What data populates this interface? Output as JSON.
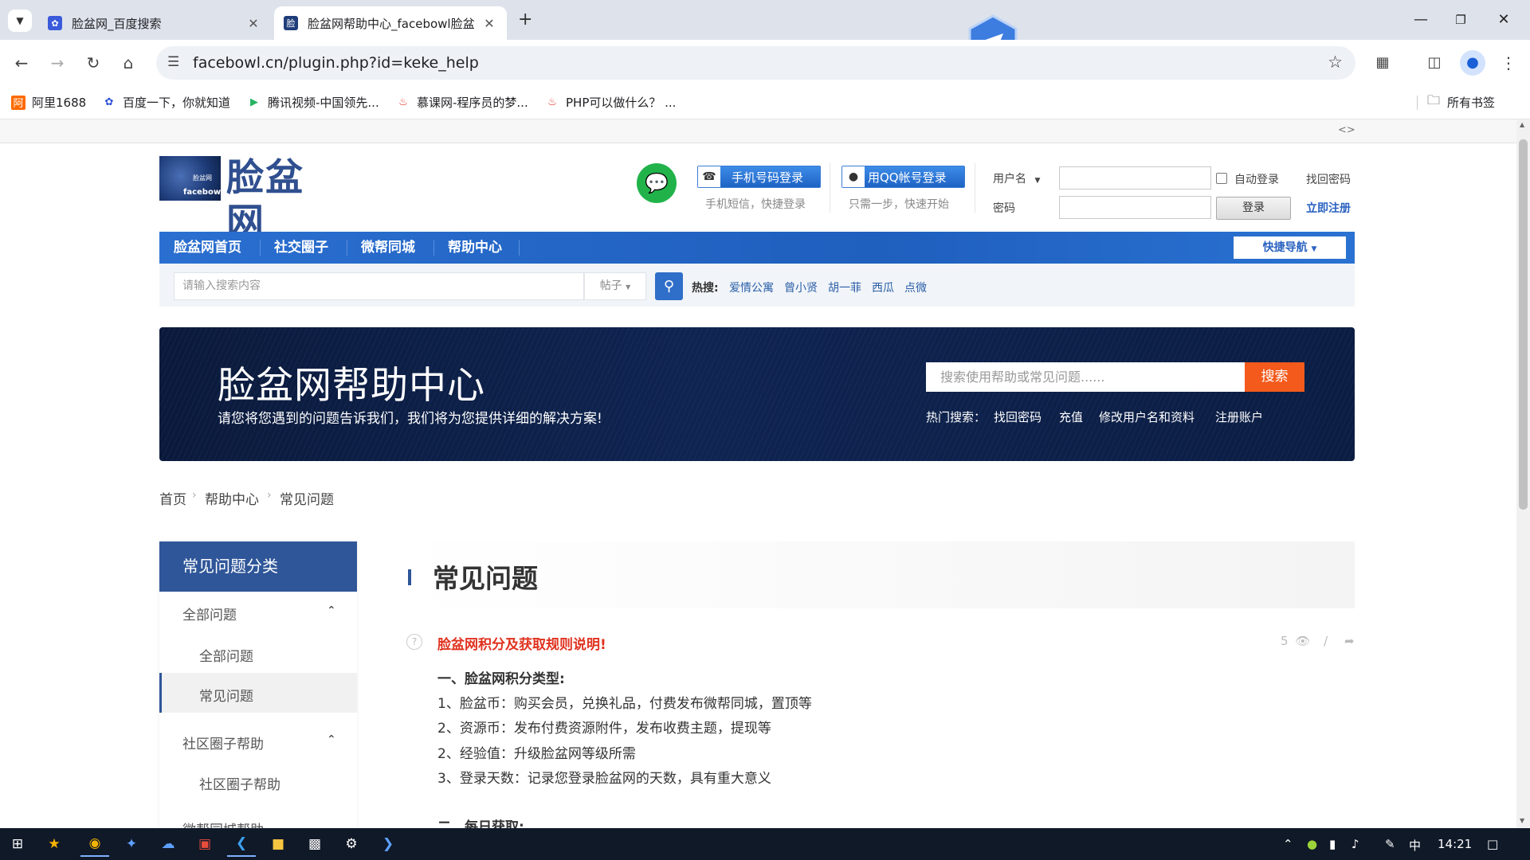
{
  "browser": {
    "tabs": [
      {
        "title": "脸盆网_百度搜索",
        "active": false
      },
      {
        "title": "脸盆网帮助中心_facebowl脸盆",
        "active": true
      }
    ],
    "url": "facebowl.cn/plugin.php?id=keke_help",
    "bookmarks": [
      {
        "label": "阿里1688"
      },
      {
        "label": "百度一下，你就知道"
      },
      {
        "label": "腾讯视频-中国领先..."
      },
      {
        "label": "慕课网-程序员的梦..."
      },
      {
        "label": "PHP可以做什么？ ..."
      }
    ],
    "all_bookmarks": "所有书签"
  },
  "header": {
    "logo_text": "脸盆网",
    "logo_small_top": "脸盆网",
    "logo_small_bottom": "facebowl",
    "phone_login": "手机号码登录",
    "phone_login_sub": "手机短信，快捷登录",
    "qq_login": "用QQ帐号登录",
    "qq_login_sub": "只需一步，快速开始",
    "username_label": "用户名",
    "password_label": "密码",
    "auto_login": "自动登录",
    "find_password": "找回密码",
    "login_button": "登录",
    "register": "立即注册"
  },
  "nav": {
    "items": [
      "脸盆网首页",
      "社交圈子",
      "微帮同城",
      "帮助中心"
    ],
    "quick_nav": "快捷导航"
  },
  "search": {
    "placeholder": "请输入搜索内容",
    "type": "帖子",
    "hot_label": "热搜:",
    "hot_words": [
      "爱情公寓",
      "曾小贤",
      "胡一菲",
      "西瓜",
      "点微"
    ]
  },
  "banner": {
    "title": "脸盆网帮助中心",
    "subtitle": "请您将您遇到的问题告诉我们，我们将为您提供详细的解决方案!",
    "search_placeholder": "搜索使用帮助或常见问题......",
    "search_button": "搜索",
    "hot_label": "热门搜索：",
    "hot_items": [
      "找回密码",
      "充值",
      "修改用户名和资料",
      "注册账户"
    ]
  },
  "breadcrumb": [
    "首页",
    "帮助中心",
    "常见问题"
  ],
  "sidebar": {
    "title": "常见问题分类",
    "groups": [
      {
        "label": "全部问题",
        "items": [
          "全部问题",
          "常见问题"
        ]
      },
      {
        "label": "社区圈子帮助",
        "items": [
          "社区圈子帮助"
        ]
      },
      {
        "label": "微帮同城帮助",
        "items": []
      }
    ]
  },
  "main": {
    "title": "常见问题",
    "question_title": "脸盆网积分及获取规则说明!",
    "views": "5",
    "content": [
      "一、脸盆网积分类型:",
      "1、脸盆币：购买会员，兑换礼品，付费发布微帮同城，置顶等",
      "2、资源币：发布付费资源附件，发布收费主题，提现等",
      "2、经验值：升级脸盆网等级所需",
      "3、登录天数：记录您登录脸盆网的天数，具有重大意义",
      "二、每日获取:"
    ]
  },
  "taskbar": {
    "ime": "中",
    "time": "14:21"
  }
}
